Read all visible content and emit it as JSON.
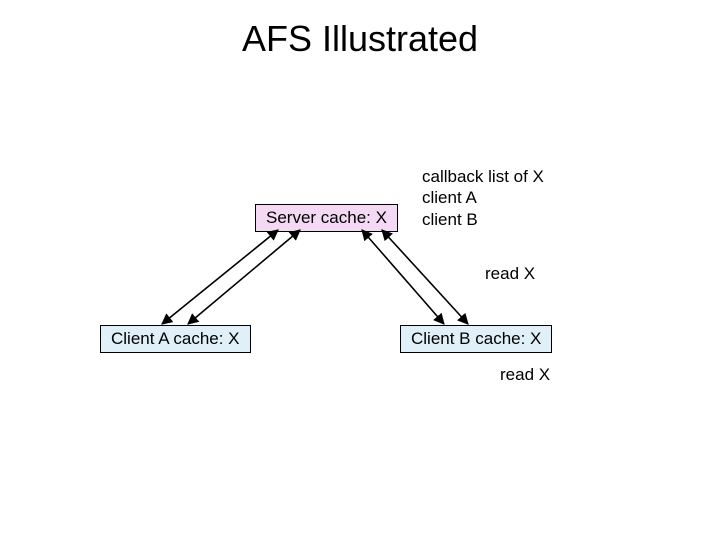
{
  "title": "AFS Illustrated",
  "server": {
    "label": "Server cache:  X"
  },
  "callback": {
    "line1": "callback list of X",
    "line2": "client A",
    "line3": "client B"
  },
  "clientA": {
    "label": "Client A cache: X"
  },
  "clientB": {
    "label": "Client B cache: X"
  },
  "readX_upper": "read X",
  "readX_lower": "read X"
}
